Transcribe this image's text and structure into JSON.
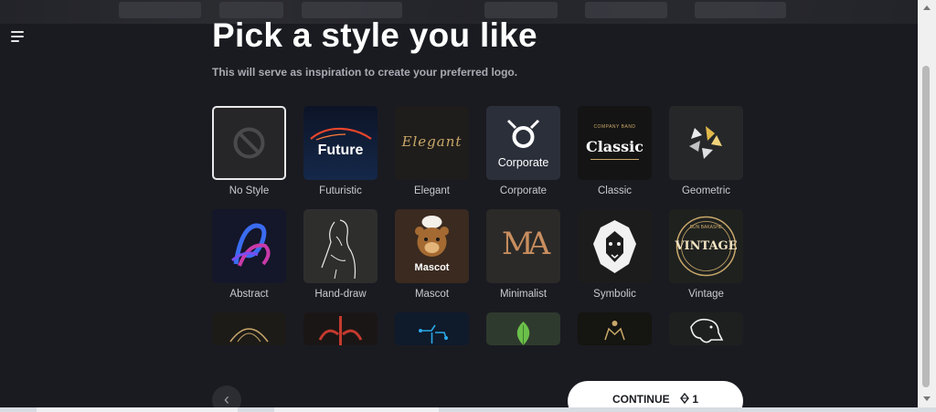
{
  "header": {
    "title": "Pick a style you like",
    "subtitle": "This will serve as inspiration to create your preferred logo."
  },
  "styles": [
    {
      "label": "No Style",
      "selected": true
    },
    {
      "label": "Futuristic",
      "thumb_text": "Future"
    },
    {
      "label": "Elegant",
      "thumb_text": "Elegant"
    },
    {
      "label": "Corporate",
      "thumb_text": "Corporate"
    },
    {
      "label": "Classic",
      "thumb_text": "Classic",
      "thumb_small": "COMPANY BAND"
    },
    {
      "label": "Geometric"
    },
    {
      "label": "Abstract"
    },
    {
      "label": "Hand-draw"
    },
    {
      "label": "Mascot",
      "thumb_text": "Mascot"
    },
    {
      "label": "Minimalist",
      "thumb_text": "MA"
    },
    {
      "label": "Symbolic"
    },
    {
      "label": "Vintage",
      "thumb_text": "VINTAGE",
      "thumb_small": "BUN BAKASHE"
    }
  ],
  "navigation": {
    "prev_icon": "chevron-left-icon",
    "continue_label": "CONTINUE",
    "credit_icon": "diamond-icon",
    "credit_count": "1"
  },
  "colors": {
    "background": "#1a1b21",
    "accent": "#ffffff",
    "label": "#c9cad0"
  }
}
